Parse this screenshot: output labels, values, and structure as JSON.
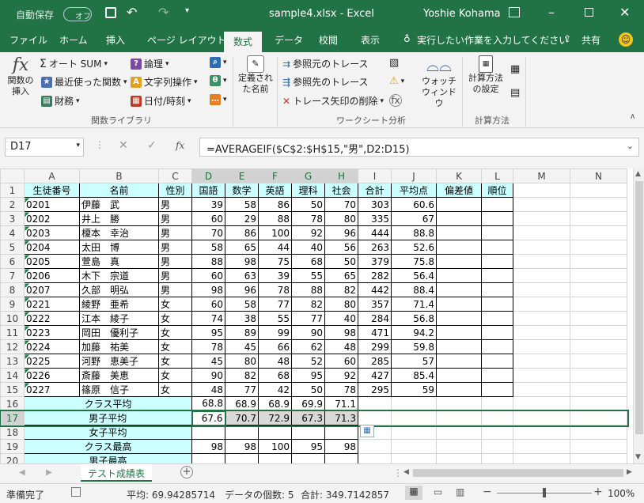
{
  "window": {
    "autosave_label": "自動保存",
    "autosave_state": "オフ",
    "title": "sample4.xlsx  -  Excel",
    "user": "Yoshie Kohama"
  },
  "ribbon_tabs": [
    "ファイル",
    "ホーム",
    "挿入",
    "ページ レイアウト",
    "数式",
    "データ",
    "校閲",
    "表示"
  ],
  "active_tab": "数式",
  "tell_me": "実行したい作業を入力してください",
  "share": "共有",
  "ribbon": {
    "insert_function": "関数の\n挿入",
    "autosum": "オート SUM",
    "recent": "最近使った関数",
    "financial": "財務",
    "logical": "論理",
    "text": "文字列操作",
    "datetime": "日付/時刻",
    "define_name": "定義され\nた名前",
    "trace_precedents": "参照元のトレース",
    "trace_dependents": "参照先のトレース",
    "remove_arrows": "トレース矢印の削除",
    "watch": "ウォッチ\nウィンドウ",
    "calc_options": "計算方法\nの設定",
    "group_library": "関数ライブラリ",
    "group_audit": "ワークシート分析",
    "group_calc": "計算方法"
  },
  "name_box": "D17",
  "formula": "=AVERAGEIF($C$2:$H$15,\"男\",D2:D15)",
  "columns": [
    "A",
    "B",
    "C",
    "D",
    "E",
    "F",
    "G",
    "H",
    "I",
    "J",
    "K",
    "L",
    "M",
    "N"
  ],
  "rows": [
    [
      "生徒番号",
      "名前",
      "性別",
      "国語",
      "数学",
      "英語",
      "理科",
      "社会",
      "合計",
      "平均点",
      "偏差値",
      "順位",
      "",
      ""
    ],
    [
      "0201",
      "伊藤　武",
      "男",
      "39",
      "58",
      "86",
      "50",
      "70",
      "303",
      "60.6",
      "",
      "",
      "",
      ""
    ],
    [
      "0202",
      "井上　勝",
      "男",
      "60",
      "29",
      "88",
      "78",
      "80",
      "335",
      "67",
      "",
      "",
      "",
      ""
    ],
    [
      "0203",
      "榎本　幸治",
      "男",
      "70",
      "86",
      "100",
      "92",
      "96",
      "444",
      "88.8",
      "",
      "",
      "",
      ""
    ],
    [
      "0204",
      "太田　博",
      "男",
      "58",
      "65",
      "44",
      "40",
      "56",
      "263",
      "52.6",
      "",
      "",
      "",
      ""
    ],
    [
      "0205",
      "萱島　真",
      "男",
      "88",
      "98",
      "75",
      "68",
      "50",
      "379",
      "75.8",
      "",
      "",
      "",
      ""
    ],
    [
      "0206",
      "木下　宗道",
      "男",
      "60",
      "63",
      "39",
      "55",
      "65",
      "282",
      "56.4",
      "",
      "",
      "",
      ""
    ],
    [
      "0207",
      "久部　明弘",
      "男",
      "98",
      "96",
      "78",
      "88",
      "82",
      "442",
      "88.4",
      "",
      "",
      "",
      ""
    ],
    [
      "0221",
      "綾野　亜希",
      "女",
      "60",
      "58",
      "77",
      "82",
      "80",
      "357",
      "71.4",
      "",
      "",
      "",
      ""
    ],
    [
      "0222",
      "江本　綾子",
      "女",
      "74",
      "38",
      "55",
      "77",
      "40",
      "284",
      "56.8",
      "",
      "",
      "",
      ""
    ],
    [
      "0223",
      "岡田　優利子",
      "女",
      "95",
      "89",
      "99",
      "90",
      "98",
      "471",
      "94.2",
      "",
      "",
      "",
      ""
    ],
    [
      "0224",
      "加藤　祐美",
      "女",
      "78",
      "45",
      "66",
      "62",
      "48",
      "299",
      "59.8",
      "",
      "",
      "",
      ""
    ],
    [
      "0225",
      "河野　恵美子",
      "女",
      "45",
      "80",
      "48",
      "52",
      "60",
      "285",
      "57",
      "",
      "",
      "",
      ""
    ],
    [
      "0226",
      "斎藤　美恵",
      "女",
      "90",
      "82",
      "68",
      "95",
      "92",
      "427",
      "85.4",
      "",
      "",
      "",
      ""
    ],
    [
      "0227",
      "篠原　信子",
      "女",
      "48",
      "77",
      "42",
      "50",
      "78",
      "295",
      "59",
      "",
      "",
      "",
      ""
    ],
    [
      "クラス平均",
      "",
      "",
      "68.8",
      "68.9",
      "68.9",
      "69.9",
      "71.1",
      "",
      "",
      "",
      "",
      "",
      ""
    ],
    [
      "男子平均",
      "",
      "",
      "67.6",
      "70.7",
      "72.9",
      "67.3",
      "71.3",
      "",
      "",
      "",
      "",
      "",
      ""
    ],
    [
      "女子平均",
      "",
      "",
      "",
      "",
      "",
      "",
      "",
      "",
      "",
      "",
      "",
      "",
      ""
    ],
    [
      "クラス最高",
      "",
      "",
      "98",
      "98",
      "100",
      "95",
      "98",
      "",
      "",
      "",
      "",
      "",
      ""
    ],
    [
      "男子最高",
      "",
      "",
      "",
      "",
      "",
      "",
      "",
      "",
      "",
      "",
      "",
      "",
      ""
    ]
  ],
  "sheet_tab": "テスト成績表",
  "status": {
    "ready": "準備完了",
    "average": "平均: 69.94285714",
    "count": "データの個数: 5",
    "sum": "合計: 349.7142857",
    "zoom": "100%"
  }
}
